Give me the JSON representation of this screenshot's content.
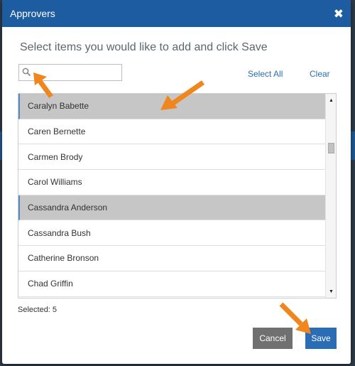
{
  "dialog": {
    "title": "Approvers",
    "close_glyph": "✖",
    "instructions": "Select items you would like to add and click Save"
  },
  "search": {
    "value": "",
    "placeholder": "",
    "icon": "search-icon"
  },
  "actions": {
    "select_all_label": "Select All",
    "clear_label": "Clear"
  },
  "list": {
    "items": [
      {
        "label": "Caralyn Babette",
        "selected": true
      },
      {
        "label": "Caren Bernette",
        "selected": false
      },
      {
        "label": "Carmen Brody",
        "selected": false
      },
      {
        "label": "Carol Williams",
        "selected": false
      },
      {
        "label": "Cassandra Anderson",
        "selected": true
      },
      {
        "label": "Cassandra Bush",
        "selected": false
      },
      {
        "label": "Catherine Bronson",
        "selected": false
      },
      {
        "label": "Chad Griffin",
        "selected": false
      }
    ],
    "scroll_up_glyph": "▲",
    "scroll_down_glyph": "▼"
  },
  "footer": {
    "selected_text": "Selected: 5",
    "cancel_label": "Cancel",
    "save_label": "Save"
  },
  "colors": {
    "titlebar": "#1e5ca1",
    "selected_row": "#c6c6c6",
    "link": "#2a6db5",
    "annotation_arrow": "#f0861e"
  }
}
